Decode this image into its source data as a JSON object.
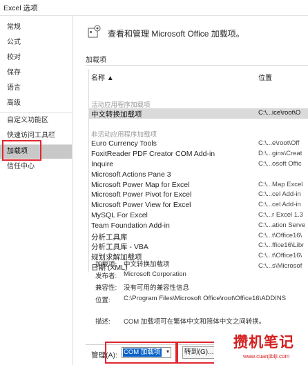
{
  "window": {
    "title": "Excel 选项"
  },
  "sidebar": {
    "items": [
      {
        "label": "常规"
      },
      {
        "label": "公式"
      },
      {
        "label": "校对"
      },
      {
        "label": "保存"
      },
      {
        "label": "语言"
      },
      {
        "label": "高级"
      },
      {
        "label": "自定义功能区"
      },
      {
        "label": "快速访问工具栏"
      },
      {
        "label": "加载项",
        "selected": true
      },
      {
        "label": "信任中心"
      }
    ]
  },
  "header": {
    "title": "查看和管理 Microsoft Office 加载项。",
    "icon": "addins-gear-icon"
  },
  "section": {
    "label": "加载项"
  },
  "list": {
    "col_name": "名称 ▲",
    "col_location": "位置",
    "groups": {
      "active": "活动应用程序加载项",
      "inactive": "非活动应用程序加载项"
    },
    "active_rows": [
      {
        "name": "中文转换加载项",
        "location": "C:\\...ice\\root\\O"
      }
    ],
    "inactive_rows": [
      {
        "name": "Euro Currency Tools",
        "location": "C:\\...e\\root\\Off"
      },
      {
        "name": "FoxitReader PDF Creator COM Add-in",
        "location": "D:\\...gins\\Creat"
      },
      {
        "name": "Inquire",
        "location": "C:\\...osoft Offic"
      },
      {
        "name": "Microsoft Actions Pane 3",
        "location": ""
      },
      {
        "name": "Microsoft Power Map for Excel",
        "location": "C:\\...Map Excel"
      },
      {
        "name": "Microsoft Power Pivot for Excel",
        "location": "C:\\...cel Add-in"
      },
      {
        "name": "Microsoft Power View for Excel",
        "location": "C:\\...cel Add-in"
      },
      {
        "name": "MySQL For Excel",
        "location": "C:\\...r Excel 1.3"
      },
      {
        "name": "Team Foundation Add-in",
        "location": "C:\\...ation Serve"
      },
      {
        "name": "分析工具库",
        "location": "C:\\...t\\Office16\\"
      },
      {
        "name": "分析工具库 - VBA",
        "location": "C:\\...ffice16\\Libr"
      },
      {
        "name": "规划求解加载项",
        "location": "C:\\...t\\Office16\\"
      },
      {
        "name": "日期 (XML)",
        "location": "C:\\...s\\Microsof"
      }
    ]
  },
  "details": {
    "addin_label": "加载项:",
    "addin_value": "中文转换加载项",
    "publisher_label": "发布者:",
    "publisher_value": "Microsoft Corporation",
    "compat_label": "兼容性:",
    "compat_value": "没有可用的兼容性信息",
    "location_label": "位置:",
    "location_value": "C:\\Program Files\\Microsoft Office\\root\\Office16\\ADDINS",
    "desc_label": "描述:",
    "desc_value": "COM 加载项可在繁体中文和简体中文之间转换。"
  },
  "footer": {
    "manage_label": "管理(A):",
    "manage_value": "COM 加载项",
    "goto_label": "转到(G)..."
  },
  "watermark": {
    "text": "攒机笔记",
    "url": "www.cuanjibiji.com"
  },
  "colors": {
    "highlight_box": "#e0262f",
    "selected_nav": "#c8c8c8",
    "select_fill": "#0a64c8"
  }
}
